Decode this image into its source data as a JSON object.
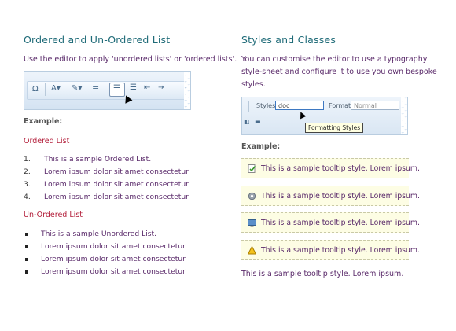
{
  "left": {
    "title": "Ordered and Un-Ordered List",
    "intro": "Use the editor to apply 'unordered lists' or 'ordered lists'.",
    "toolbar_icons": [
      "omega-icon",
      "text-color-icon",
      "highlight-icon",
      "horizontal-rule-icon",
      "ordered-list-icon",
      "unordered-list-icon",
      "outdent-icon",
      "indent-icon"
    ],
    "example_label": "Example:",
    "ordered_heading": "Ordered List",
    "ordered_items": [
      {
        "num": "1.",
        "text": "This is a sample Ordered List."
      },
      {
        "num": "2.",
        "text": "Lorem ipsum dolor sit amet consectetur"
      },
      {
        "num": "3.",
        "text": "Lorem ipsum dolor sit amet consectetur"
      },
      {
        "num": "4.",
        "text": "Lorem ipsum dolor sit amet consectetur"
      }
    ],
    "unordered_heading": "Un-Ordered List",
    "unordered_items": [
      "This is a sample Unordered List.",
      "Lorem ipsum dolor sit amet consectetur",
      "Lorem ipsum dolor sit amet consectetur",
      "Lorem ipsum dolor sit amet consectetur"
    ]
  },
  "right": {
    "title": "Styles and Classes",
    "intro_lines": [
      "You can customise the editor to use a typography",
      "style-sheet and configure it to use you own bespoke",
      "styles."
    ],
    "toolbar": {
      "styles_label": "Styles",
      "styles_value": "doc",
      "format_label": "Format",
      "format_value": "Normal",
      "tooltip": "Formatting Styles"
    },
    "example_label": "Example:",
    "tips": [
      {
        "icon": "check-document-icon",
        "text": "This is a sample tooltip style. Lorem ipsum."
      },
      {
        "icon": "gear-icon",
        "text": "This is a sample tooltip style. Lorem ipsum."
      },
      {
        "icon": "monitor-icon",
        "text": "This is a sample tooltip style. Lorem ipsum."
      },
      {
        "icon": "warning-icon",
        "text": "This is a sample tooltip style. Lorem ipsum."
      }
    ],
    "footer_text": "This is a sample tooltip style. Lorem ipsum."
  },
  "colors": {
    "heading": "#1f6b78",
    "subheading": "#b31e3a",
    "body_text": "#5a2a6a",
    "tip_background": "#fdfde4"
  }
}
